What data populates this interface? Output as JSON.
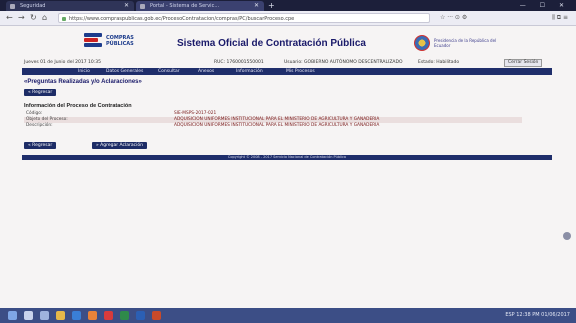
{
  "browser": {
    "tabs": [
      {
        "label": "Seguridad"
      },
      {
        "label": "Portal - Sistema de Servic..."
      }
    ],
    "new_tab": "+",
    "window_controls": "— ☐ ✕",
    "nav": {
      "back": "←",
      "forward": "→",
      "reload": "↻",
      "home": "⌂"
    },
    "url": "https://www.compraspublicas.gob.ec/ProcesoContratacion/compras/PC/buscarProceso.cpe",
    "url_tools": "☆ ··· ⊙ ⚙",
    "right_tools": "⫼ ⧉ ≡"
  },
  "header": {
    "logo_text": "COMPRAS PÚBLICAS",
    "title": "Sistema Oficial de Contratación Pública",
    "right_logo_text": "Presidencia de la República del Ecuador"
  },
  "infobar": {
    "date": "Jueves 01 de Junio del 2017 10:35",
    "ruc": "RUC: 1760001550001",
    "entity": "Usuario: GOBIERNO AUTÓNOMO DESCENTRALIZADO",
    "status": "Estado: Habilitado",
    "close_label": "Cerrar Sesión"
  },
  "menu": {
    "items": [
      "Inicio",
      "Datos Generales",
      "Consultar",
      "Anexos",
      "Información",
      "Mis Procesos"
    ]
  },
  "section": {
    "title": "«Preguntas Realizadas y/o Aclaraciones»",
    "top_button": "« Regresar"
  },
  "info": {
    "title": "Información del Proceso de Contratación",
    "rows": [
      {
        "key": "Código:",
        "value": "SIE-MSPS-2017-021"
      },
      {
        "key": "Objeto del Proceso:",
        "value": "ADQUISICION UNIFORMES INSTITUCIONAL PARA EL MINISTERIO DE AGRICULTURA Y GANADERIA"
      },
      {
        "key": "Descripción:",
        "value": "ADQUISICION UNIFORMES INSTITUCIONAL PARA EL MINISTERIO DE AGRICULTURA Y GANADERIA"
      }
    ]
  },
  "buttons": {
    "back": "« Regresar",
    "new_question": "» Agregar Aclaración"
  },
  "footer": {
    "text": "Copyright © 2008 - 2017 Servicio Nacional de Contratación Pública"
  },
  "taskbar": {
    "tray": "ESP  12:38 PM  01/06/2017"
  }
}
